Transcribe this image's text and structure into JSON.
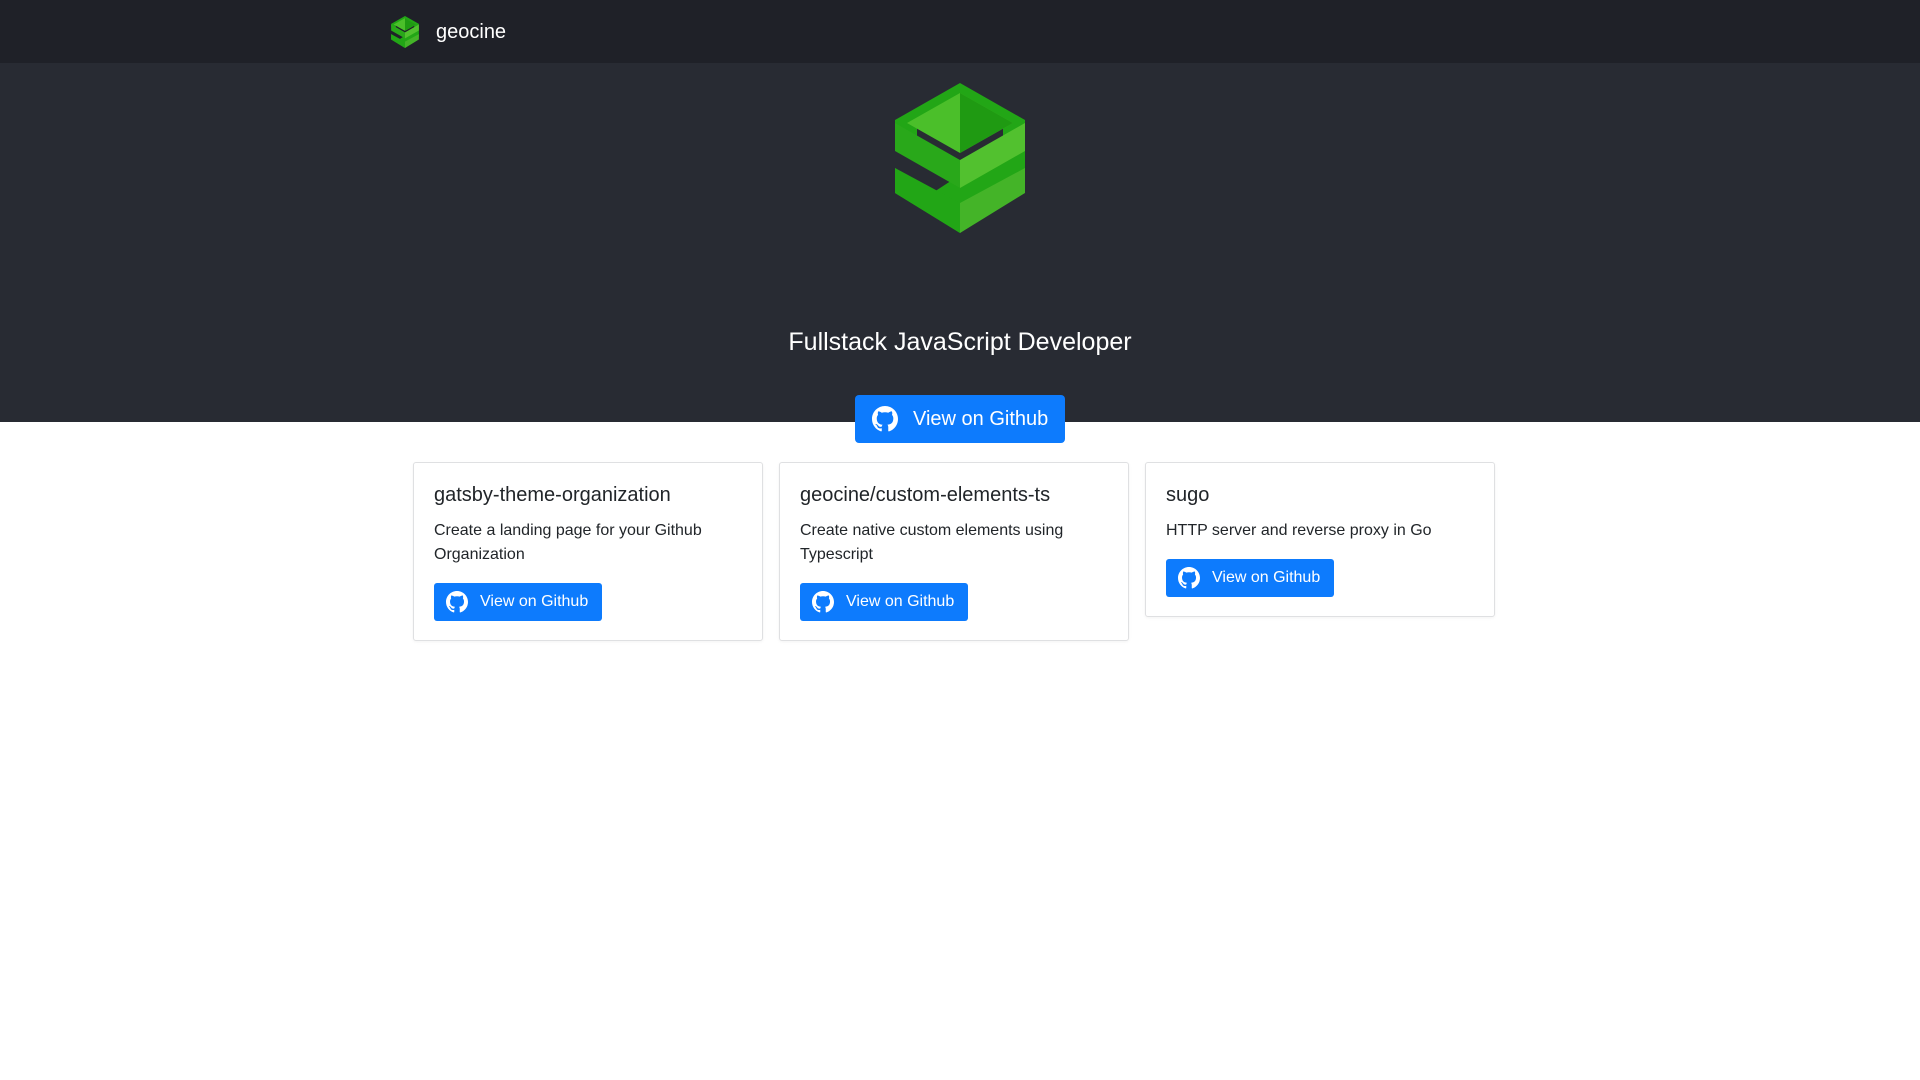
{
  "navbar": {
    "brand": "geocine",
    "logo_icon": "geocine-logo-icon"
  },
  "hero": {
    "logo_icon": "geocine-logo-icon",
    "subtitle": "Fullstack JavaScript Developer",
    "button_label": "View on Github",
    "button_icon": "github-icon"
  },
  "cards": [
    {
      "title": "gatsby-theme-organization",
      "description": "Create a landing page for your Github Organization",
      "button_label": "View on Github",
      "button_icon": "github-icon"
    },
    {
      "title": "geocine/custom-elements-ts",
      "description": "Create native custom elements using Typescript",
      "button_label": "View on Github",
      "button_icon": "github-icon"
    },
    {
      "title": "sugo",
      "description": "HTTP server and reverse proxy in Go",
      "button_label": "View on Github",
      "button_icon": "github-icon"
    }
  ],
  "colors": {
    "navbar_bg": "#1f2128",
    "hero_bg": "#282b33",
    "primary_button": "#0d7bfd",
    "logo_dark_green": "#22a616",
    "logo_light_green": "#4bbf2a"
  }
}
